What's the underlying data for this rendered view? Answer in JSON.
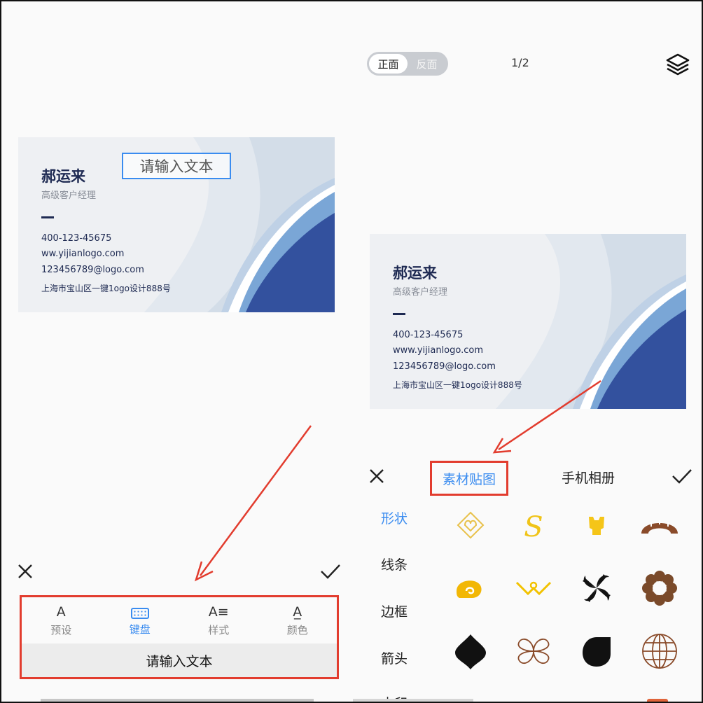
{
  "left_editor": {
    "card": {
      "name": "郝运来",
      "job_title": "高级客户经理",
      "phone": "400-123-45675",
      "website": "ww.yijianlogo.com",
      "email": "123456789@logo.com",
      "address": "上海市宝山区一键1ogo设计888号"
    },
    "text_box_placeholder": "请输入文本",
    "toolbar": {
      "tabs": [
        {
          "icon": "A",
          "label": "预设"
        },
        {
          "icon": "keyboard",
          "label": "键盘"
        },
        {
          "icon": "A≡",
          "label": "样式"
        },
        {
          "icon": "A̲",
          "label": "颜色"
        }
      ],
      "active_tab": "键盘",
      "input_placeholder": "请输入文本"
    }
  },
  "right_editor": {
    "side_toggle": {
      "front": "正面",
      "back": "反面",
      "active": "正面"
    },
    "page_indicator": "1/2",
    "card": {
      "name": "郝运来",
      "job_title": "高级客户经理",
      "phone": "400-123-45675",
      "website": "www.yijianlogo.com",
      "email": "123456789@logo.com",
      "address": "上海市宝山区一键1ogo设计888号"
    },
    "sticker_panel": {
      "tabs": [
        "素材贴图",
        "手机相册"
      ],
      "active_tab": "素材贴图",
      "categories": [
        "形状",
        "线条",
        "边框",
        "箭头",
        "水印"
      ],
      "active_category": "形状",
      "stickers": [
        "diamond-heart-outline",
        "letter-s-gold",
        "yellow-crown-cup",
        "brown-arch",
        "yellow-swirl-cloud",
        "yellow-ribbon-v",
        "black-pinwheel",
        "brown-flower",
        "black-drop-diamond",
        "brown-four-petal-outline",
        "black-leaf-drop",
        "brown-globe-grid"
      ]
    }
  },
  "colors": {
    "accent_blue": "#3a8cf0",
    "highlight_red": "#e23c2e",
    "card_navy": "#1e2a52",
    "card_blue": "#33519e"
  }
}
